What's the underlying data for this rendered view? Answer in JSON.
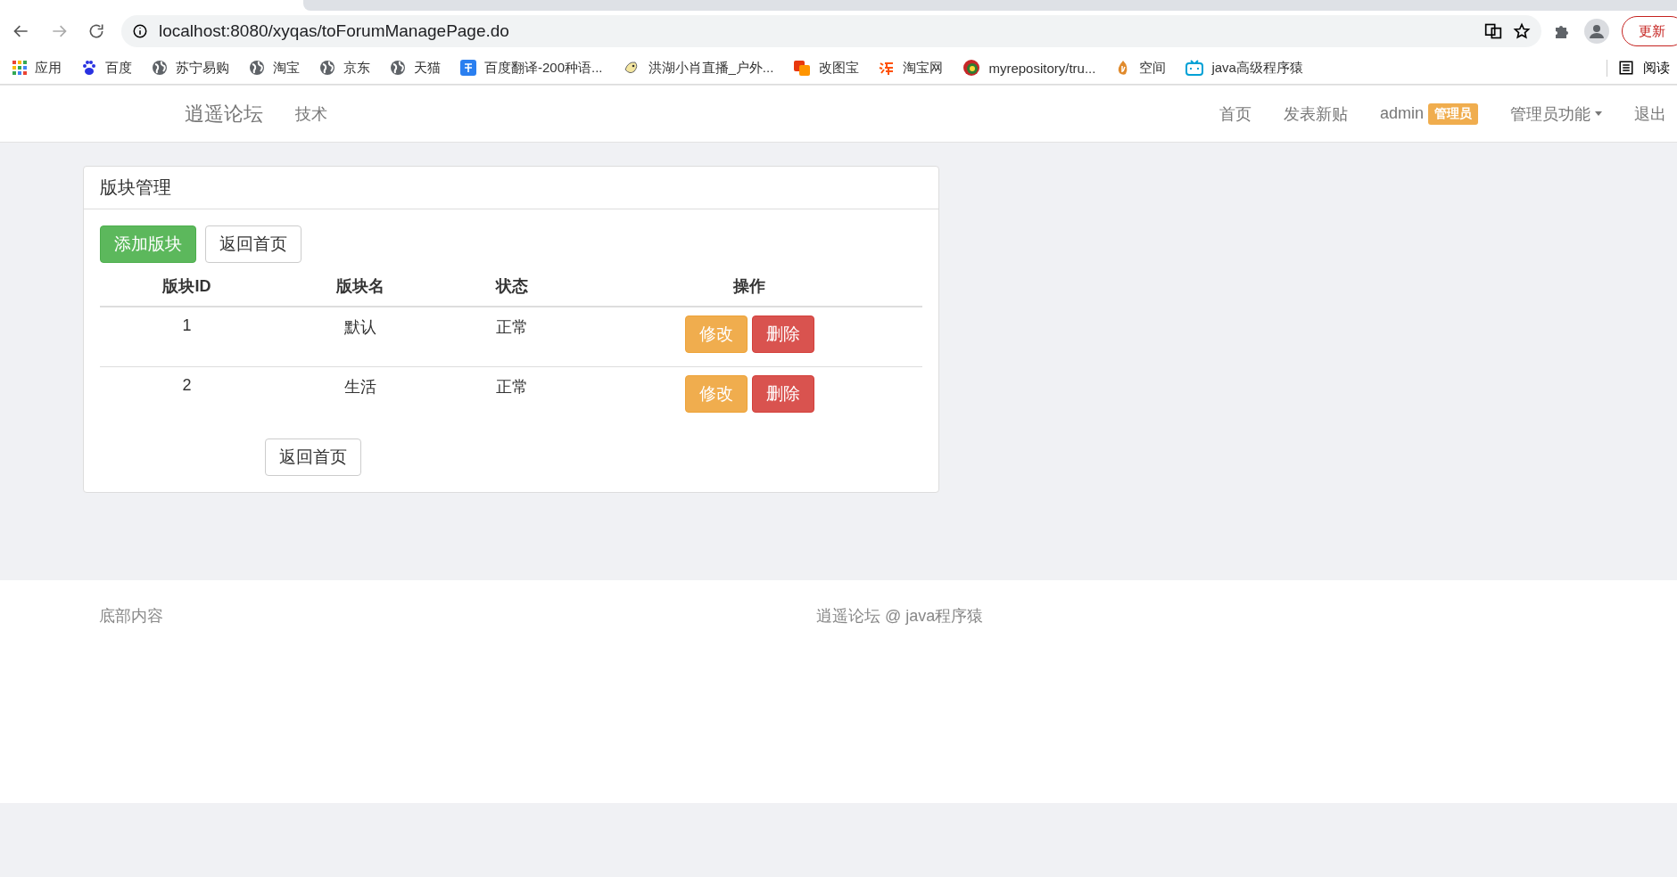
{
  "browser": {
    "url": "localhost:8080/xyqas/toForumManagePage.do",
    "update_button": "更新",
    "reading_list": "阅读",
    "bookmarks": [
      {
        "kind": "apps",
        "label": "应用"
      },
      {
        "kind": "paw",
        "label": "百度"
      },
      {
        "kind": "globe",
        "label": "苏宁易购"
      },
      {
        "kind": "globe",
        "label": "淘宝"
      },
      {
        "kind": "globe",
        "label": "京东"
      },
      {
        "kind": "globe",
        "label": "天猫"
      },
      {
        "kind": "translate",
        "label": "百度翻译-200种语..."
      },
      {
        "kind": "bird",
        "label": "洪湖小肖直播_户外..."
      },
      {
        "kind": "squares",
        "label": "改图宝"
      },
      {
        "kind": "tao",
        "label": "淘宝网"
      },
      {
        "kind": "ring",
        "label": "myrepository/tru..."
      },
      {
        "kind": "flame",
        "label": "空间"
      },
      {
        "kind": "tv",
        "label": "java高级程序猿"
      }
    ]
  },
  "navbar": {
    "brand": "逍遥论坛",
    "left_links": [
      "技术"
    ],
    "right_links": [
      {
        "kind": "link",
        "label": "首页"
      },
      {
        "kind": "link",
        "label": "发表新贴"
      },
      {
        "kind": "user",
        "label": "admin",
        "badge": "管理员"
      },
      {
        "kind": "dropdown",
        "label": "管理员功能"
      },
      {
        "kind": "link",
        "label": "退出"
      }
    ]
  },
  "panel": {
    "title": "版块管理",
    "add_button": "添加版块",
    "back_button": "返回首页",
    "table": {
      "columns": [
        "版块ID",
        "版块名",
        "状态",
        "操作"
      ],
      "rows": [
        {
          "id": "1",
          "name": "默认",
          "status": "正常",
          "edit": "修改",
          "delete": "删除"
        },
        {
          "id": "2",
          "name": "生活",
          "status": "正常",
          "edit": "修改",
          "delete": "删除"
        }
      ]
    },
    "bottom_button": "返回首页"
  },
  "footer": {
    "left": "底部内容",
    "right": "逍遥论坛 @ java程序猿"
  }
}
